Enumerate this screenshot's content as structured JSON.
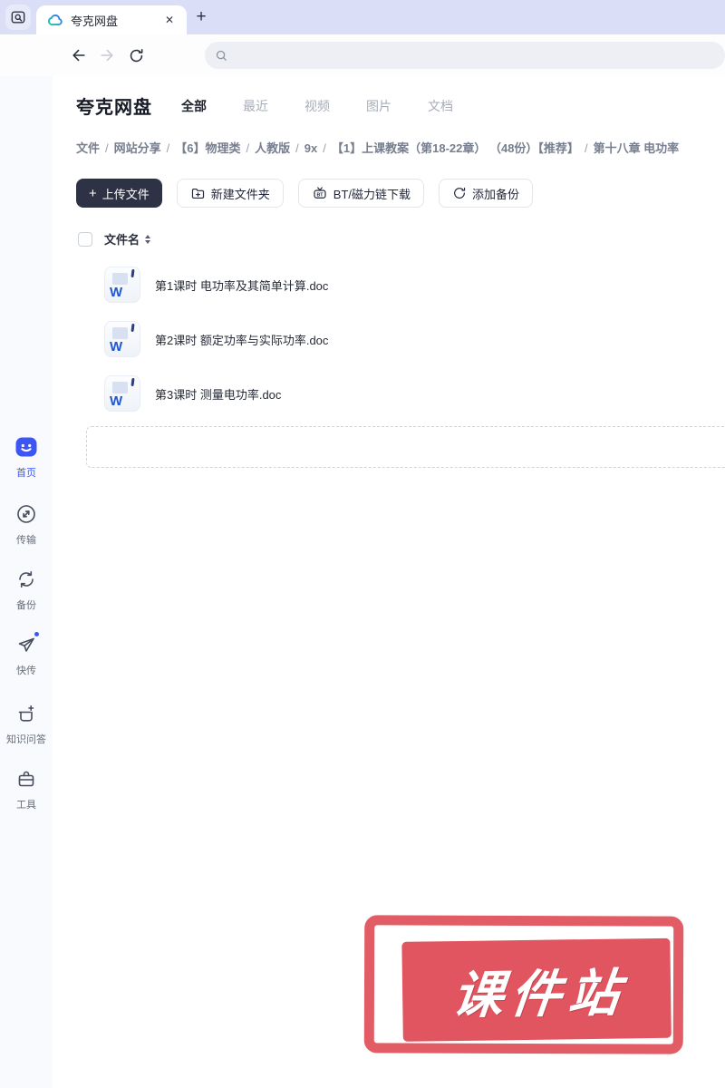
{
  "browser": {
    "tab_title": "夸克网盘"
  },
  "icons": {
    "close": "✕",
    "plus": "+",
    "bt": "BT",
    "doc_letter": "W"
  },
  "header": {
    "app_title": "夸克网盘",
    "tabs": [
      {
        "label": "全部",
        "active": true
      },
      {
        "label": "最近",
        "active": false
      },
      {
        "label": "视频",
        "active": false
      },
      {
        "label": "图片",
        "active": false
      },
      {
        "label": "文档",
        "active": false
      }
    ]
  },
  "breadcrumb": {
    "separator": "/",
    "segments": [
      "文件",
      "网站分享",
      "【6】物理类",
      "人教版",
      "9x",
      "【1】上课教案（第18-22章） （48份）【推荐】",
      "第十八章 电功率"
    ]
  },
  "actions": {
    "upload": "上传文件",
    "new_folder": "新建文件夹",
    "bt_download": "BT/磁力链下载",
    "add_backup": "添加备份"
  },
  "file_list": {
    "name_column": "文件名",
    "files": [
      {
        "name": "第1课时 电功率及其简单计算.doc"
      },
      {
        "name": "第2课时 额定功率与实际功率.doc"
      },
      {
        "name": "第3课时 测量电功率.doc"
      }
    ]
  },
  "sidebar": {
    "items": [
      {
        "label": "首页"
      },
      {
        "label": "传输"
      },
      {
        "label": "备份"
      },
      {
        "label": "快传"
      },
      {
        "label": "知识问答"
      },
      {
        "label": "工具"
      }
    ]
  },
  "watermark": {
    "text": "课件站"
  },
  "colors": {
    "accent_blue": "#3d56f3",
    "stamp_red": "#e0555f",
    "dark_button": "#2d3245",
    "tabbar_lavender": "#dadef6"
  }
}
